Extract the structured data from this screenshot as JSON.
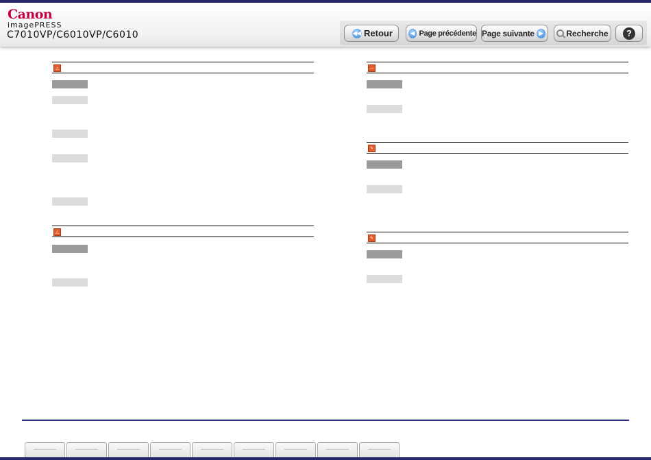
{
  "header": {
    "logo": "Canon",
    "product_line": "imagePRESS",
    "model": "C7010VP/C6010VP/C6010"
  },
  "toolbar": {
    "back": "Retour",
    "prev": "Page précédente",
    "next": "Page suivante",
    "search": "Recherche",
    "help": "?"
  },
  "icons": {
    "back": "rewind-icon",
    "prev": "arrow-left-icon",
    "next": "arrow-right-icon",
    "search": "magnifier-icon",
    "help": "question-icon",
    "warning": "warning-icon",
    "prohibited": "prohibited-icon",
    "note": "note-icon"
  },
  "colors": {
    "accent": "#26286e",
    "brand": "#c5003e",
    "section_icon": "#e05a2b"
  },
  "left_column": {
    "sections": [
      {
        "icon": "warning-icon",
        "rows": [
          "dark",
          "light",
          "light",
          "light",
          "light"
        ]
      },
      {
        "icon": "warning-icon",
        "rows": [
          "dark",
          "light"
        ]
      }
    ]
  },
  "right_column": {
    "sections": [
      {
        "icon": "prohibited-icon",
        "rows": [
          "dark",
          "light"
        ]
      },
      {
        "icon": "note-icon",
        "rows": [
          "dark",
          "light"
        ]
      },
      {
        "icon": "note-icon",
        "rows": [
          "dark",
          "light"
        ]
      }
    ]
  },
  "tab_count": 9
}
